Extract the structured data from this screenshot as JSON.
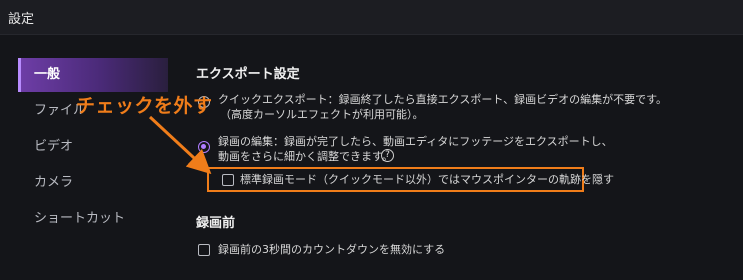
{
  "window": {
    "title": "設定"
  },
  "sidebar": {
    "items": [
      {
        "label": "一般",
        "active": true
      },
      {
        "label": "ファイル",
        "active": false
      },
      {
        "label": "ビデオ",
        "active": false
      },
      {
        "label": "カメラ",
        "active": false
      },
      {
        "label": "ショートカット",
        "active": false
      }
    ]
  },
  "export_settings": {
    "title": "エクスポート設定",
    "quick_export": {
      "line1": "クイックエクスポート：録画終了したら直接エクスポート、録画ビデオの編集が不要です。",
      "line2": "（高度カーソルエフェクトが利用可能）。",
      "selected": false
    },
    "edit_recording": {
      "line1": "録画の編集：録画が完了したら、動画エディタにフッテージをエクスポートし、",
      "line2": "動画をさらに細かく調整できます。",
      "help": "?",
      "selected": true
    },
    "hide_trail": {
      "label": "標準録画モード（クイックモード以外）ではマウスポインターの軌跡を隠す",
      "checked": false
    }
  },
  "before_recording": {
    "title": "録画前",
    "countdown": {
      "label": "録画前の3秒間のカウントダウンを無効にする",
      "checked": false
    }
  },
  "annotation": {
    "text": "チェックを外す",
    "color": "#f07d1a"
  },
  "colors": {
    "accent": "#b07cff",
    "active_tab": "#6f3ea8",
    "annotation": "#f07d1a"
  }
}
